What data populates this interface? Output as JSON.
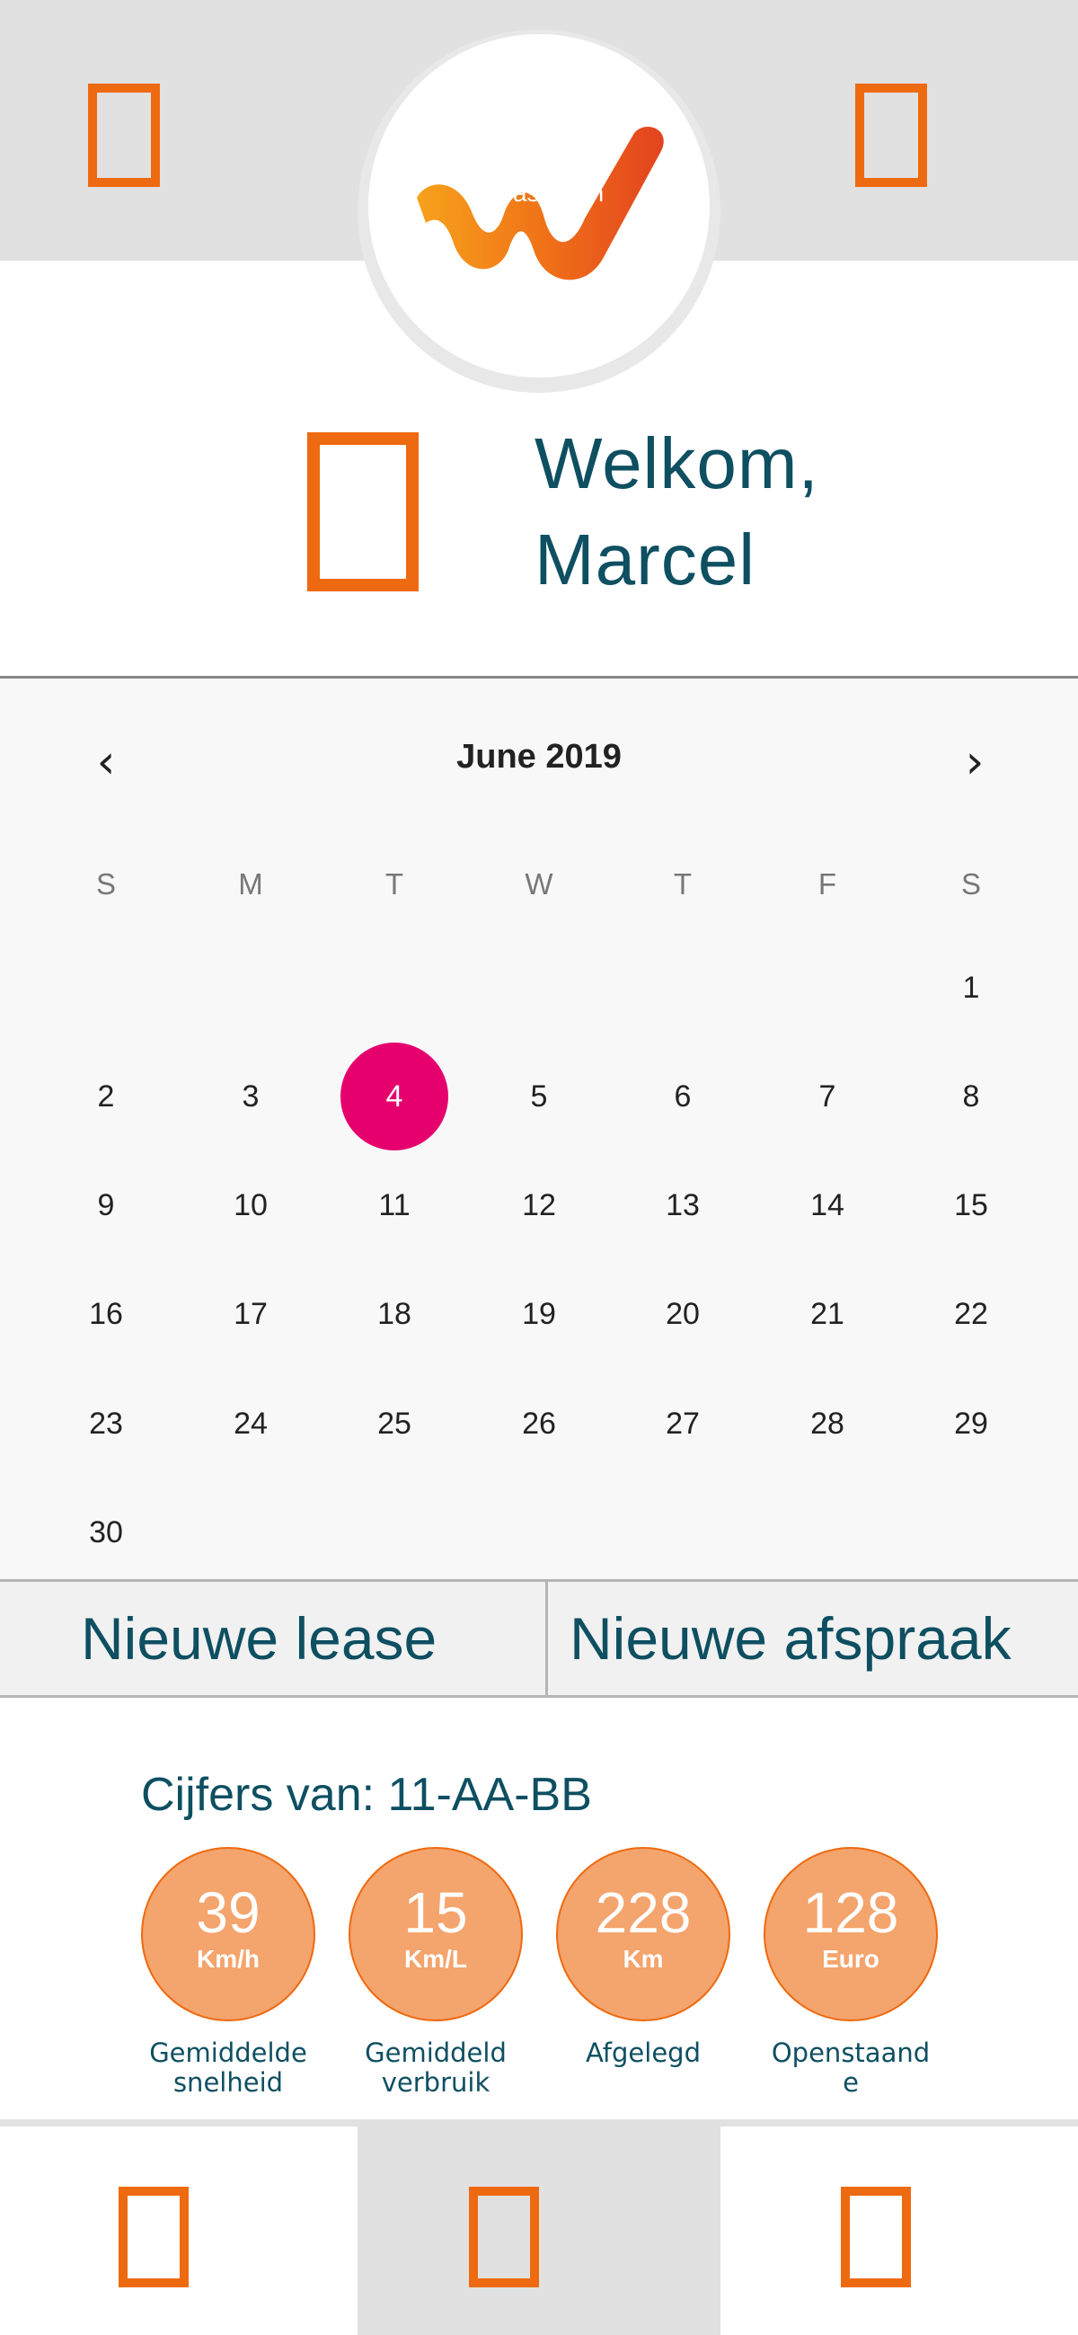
{
  "header": {
    "logo_text": "LeasePlan",
    "left_icon": "menu-icon",
    "right_icon": "profile-icon"
  },
  "welcome": {
    "icon": "user-icon",
    "line1": "Welkom,",
    "line2": "Marcel"
  },
  "calendar": {
    "title": "June 2019",
    "prev_icon": "chevron-left-icon",
    "next_icon": "chevron-right-icon",
    "prev_glyph": "‹",
    "next_glyph": "›",
    "weekdays": [
      "S",
      "M",
      "T",
      "W",
      "T",
      "F",
      "S"
    ],
    "first_weekday_index": 6,
    "days": [
      "1",
      "2",
      "3",
      "4",
      "5",
      "6",
      "7",
      "8",
      "9",
      "10",
      "11",
      "12",
      "13",
      "14",
      "15",
      "16",
      "17",
      "18",
      "19",
      "20",
      "21",
      "22",
      "23",
      "24",
      "25",
      "26",
      "27",
      "28",
      "29",
      "30"
    ],
    "selected_day": "4",
    "selected_color": "#e6006e"
  },
  "actions": {
    "new_lease": "Nieuwe lease",
    "new_appointment": "Nieuwe afspraak"
  },
  "stats": {
    "title": "Cijfers van: 11-AA-BB",
    "items": [
      {
        "value": "39",
        "unit": "Km/h",
        "label1": "Gemiddelde",
        "label2": "snelheid"
      },
      {
        "value": "15",
        "unit": "Km/L",
        "label1": "Gemiddeld",
        "label2": "verbruik"
      },
      {
        "value": "228",
        "unit": "Km",
        "label1": "Afgelegd",
        "label2": ""
      },
      {
        "value": "128",
        "unit": "Euro",
        "label1": "Openstaand",
        "label2": "e"
      }
    ]
  },
  "bottom_nav": {
    "items": [
      {
        "icon": "home-icon",
        "active": false
      },
      {
        "icon": "car-icon",
        "active": true
      },
      {
        "icon": "settings-icon",
        "active": false
      }
    ]
  },
  "colors": {
    "brand_orange": "#ee6a10",
    "stat_fill": "#f4a46d",
    "text_teal": "#0e4f61",
    "header_gray": "#e1e1e1"
  }
}
